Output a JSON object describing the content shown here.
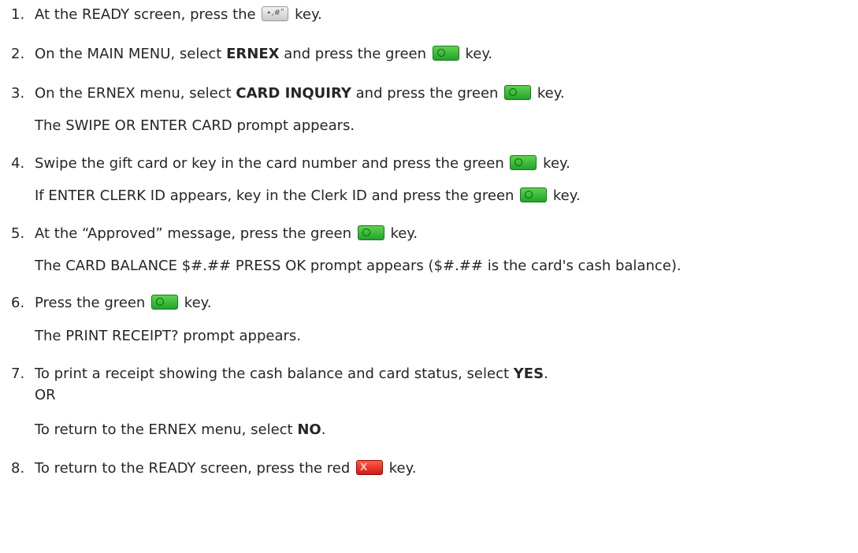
{
  "steps": [
    {
      "num": "1.",
      "a": "At the READY screen, press the ",
      "key_icon": "function-key-icon",
      "b": " key."
    },
    {
      "num": "2.",
      "a": "On the MAIN MENU, select ",
      "bold": "ERNEX",
      "b": " and press the green ",
      "key_icon": "ok-key-icon",
      "c": " key."
    },
    {
      "num": "3.",
      "a": "On the ERNEX menu, select ",
      "bold": "CARD INQUIRY",
      "b": " and press the green ",
      "key_icon": "ok-key-icon",
      "c": " key.",
      "note": "The SWIPE OR ENTER CARD prompt appears."
    },
    {
      "num": "4.",
      "a": "Swipe the gift card or key in the card number and press the green ",
      "key_icon": "ok-key-icon",
      "b": " key.",
      "note_a": "If ENTER CLERK ID appears, key in the Clerk ID and press the green ",
      "note_b": " key."
    },
    {
      "num": "5.",
      "a": "At the “Approved” message, press the green ",
      "key_icon": "ok-key-icon",
      "b": " key.",
      "note": "The CARD BALANCE $#.## PRESS OK prompt appears ($#.## is the card's cash balance)."
    },
    {
      "num": "6.",
      "a": "Press the green ",
      "key_icon": "ok-key-icon",
      "b": " key.",
      "note": "The PRINT RECEIPT? prompt appears."
    },
    {
      "num": "7.",
      "a": "To print a receipt showing the cash balance and card status, select ",
      "bold": "YES",
      "b": ".",
      "or": "OR",
      "alt_a": "To return to the ERNEX menu, select ",
      "alt_bold": "NO",
      "alt_b": "."
    },
    {
      "num": "8.",
      "a": "To return to the READY screen, press the red ",
      "key_icon": "cancel-key-icon",
      "b": " key."
    }
  ],
  "key_glyphs": {
    "function": "∙,#ʺ",
    "cancel": "X"
  },
  "colors": {
    "text": "#262626",
    "green_key": "#2fb735",
    "red_key": "#e3251b",
    "gray_key": "#d9d9d9"
  }
}
